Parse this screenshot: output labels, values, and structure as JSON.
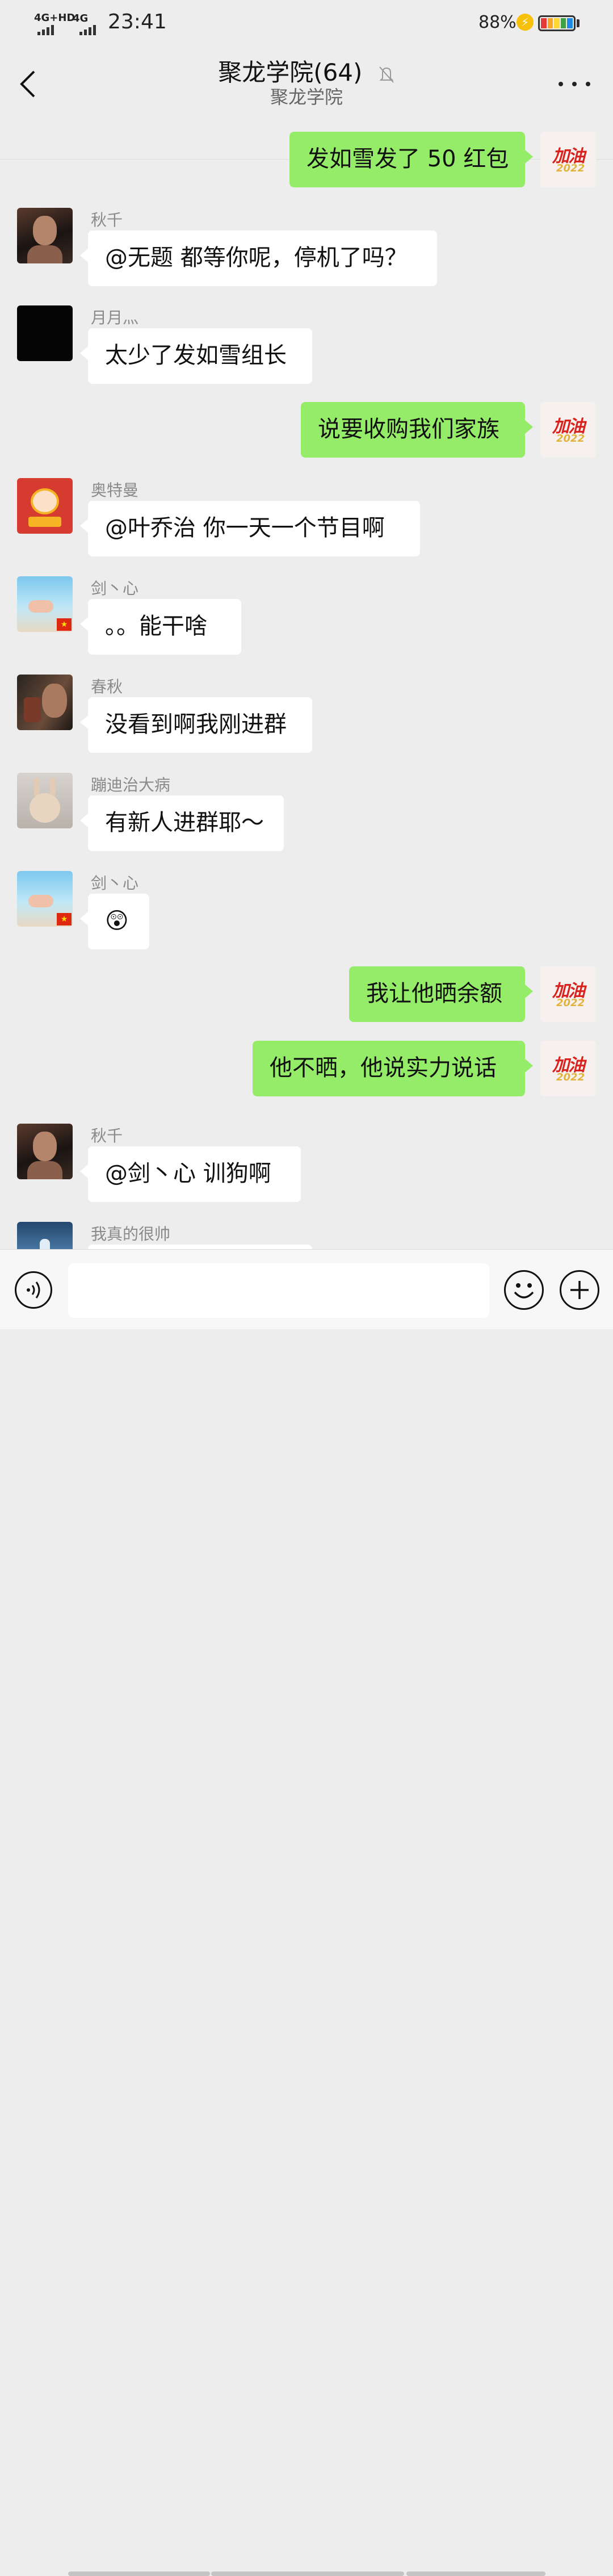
{
  "status_bar": {
    "network_left": "4G+HD",
    "network_right": "4G",
    "time": "23:41",
    "battery_percent": "88%"
  },
  "header": {
    "title": "聚龙学院(64)",
    "subtitle": "聚龙学院"
  },
  "messages": [
    {
      "dir": "out",
      "sender": "",
      "text": "发如雪发了 50 红包",
      "avatar": "self-jiayou-2022-avatar"
    },
    {
      "dir": "in",
      "sender": "秋千",
      "text": "@无题  都等你呢，停机了吗？",
      "avatar": "man-portrait-avatar"
    },
    {
      "dir": "in",
      "sender": "月月灬",
      "text": "太少了发如雪组长",
      "avatar": "black-avatar"
    },
    {
      "dir": "out",
      "sender": "",
      "text": "说要收购我们家族",
      "avatar": "self-jiayou-2022-avatar"
    },
    {
      "dir": "in",
      "sender": "奥特曼",
      "text": "@叶乔治  你一天一个节目啊",
      "avatar": "cartoon-tiger-avatar"
    },
    {
      "dir": "in",
      "sender": "剑丶心",
      "text": "。。能干啥",
      "avatar": "beach-couple-avatar"
    },
    {
      "dir": "in",
      "sender": "春秋",
      "text": "没看到啊我刚进群",
      "avatar": "drinking-man-avatar"
    },
    {
      "dir": "in",
      "sender": "蹦迪治大病",
      "text": "有新人进群耶～",
      "avatar": "cat-bunny-avatar"
    },
    {
      "dir": "in",
      "sender": "剑丶心",
      "text": "😲",
      "avatar": "beach-couple-avatar"
    },
    {
      "dir": "out",
      "sender": "",
      "text": "我让他晒余额",
      "avatar": "self-jiayou-2022-avatar"
    },
    {
      "dir": "out",
      "sender": "",
      "text": "他不晒，他说实力说话",
      "avatar": "self-jiayou-2022-avatar"
    },
    {
      "dir": "in",
      "sender": "秋千",
      "text": "@剑丶心  训狗啊",
      "avatar": "man-portrait-avatar"
    },
    {
      "dir": "in",
      "sender": "我真的很帅",
      "text": "",
      "avatar": "blue-sky-avatar"
    }
  ],
  "self_avatar_text": {
    "main": "加油",
    "year": "2022"
  },
  "input_bar": {
    "value": "",
    "voice_icon": "voice-icon",
    "emoji_icon": "emoji-icon",
    "plus_icon": "plus-icon"
  },
  "colors": {
    "background": "#ededed",
    "outgoing_bubble": "#95ec69",
    "incoming_bubble": "#ffffff"
  }
}
